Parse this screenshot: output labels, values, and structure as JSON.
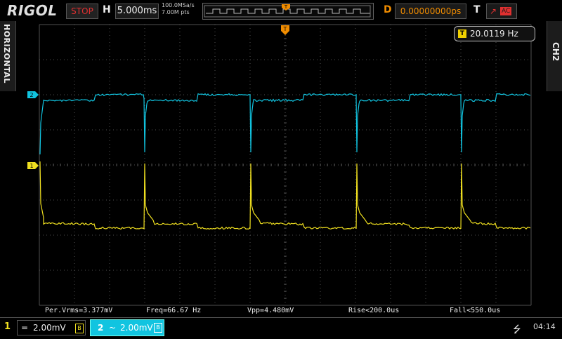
{
  "brand": "RIGOL",
  "run_state": "STOP",
  "horizontal": {
    "label": "H",
    "timebase": "5.000ms"
  },
  "acquisition": {
    "sample_rate": "100.0MSa/s",
    "memory_depth": "7.00M pts"
  },
  "delay": {
    "label": "D",
    "value": "0.00000000ps"
  },
  "trigger": {
    "label": "T",
    "edge_symbol": "↗",
    "coupling": "AC",
    "marker": "T"
  },
  "side_tabs": {
    "left": "HORIZONTAL",
    "right": "CH2"
  },
  "frequency_counter": {
    "icon": "T",
    "value": "20.0119 Hz"
  },
  "channel_markers": {
    "ch1": "1",
    "ch2": "2"
  },
  "measurements": [
    "Per.Vrms=3.377mV",
    "Freq=66.67 Hz",
    "Vpp=4.480mV",
    "Rise<200.0us",
    "Fall<550.0us"
  ],
  "channels": [
    {
      "number": "1",
      "coupling_icon": "=",
      "scale": "2.00mV",
      "bw_icon": "B",
      "color": "#f0e020"
    },
    {
      "number": "2",
      "coupling_icon": "~",
      "scale": "2.00mV",
      "bw_icon": "B",
      "color": "#11c4e0"
    }
  ],
  "clock": "04:14",
  "icons": {
    "usb": "usb-icon",
    "trigger_edge": "rising-edge-icon"
  },
  "colors": {
    "ch1": "#f0e020",
    "ch2": "#11c4e0",
    "trigger": "#f08c00",
    "stop": "#e03030",
    "grid": "#505050"
  }
}
